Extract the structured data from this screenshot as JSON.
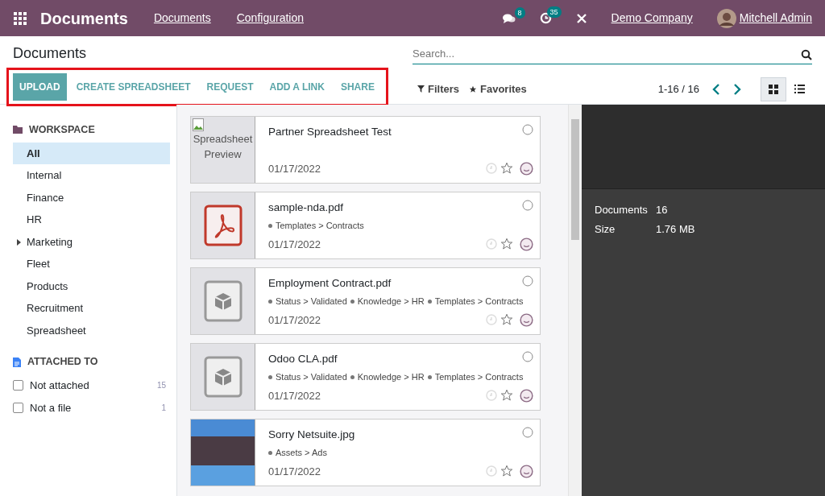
{
  "navbar": {
    "app_title": "Documents",
    "menu": [
      "Documents",
      "Configuration"
    ],
    "messages_count": "8",
    "activities_count": "35",
    "company": "Demo Company",
    "user": "Mitchell Admin"
  },
  "breadcrumb": "Documents",
  "search": {
    "placeholder": "Search..."
  },
  "toolbar": {
    "highlighted": true,
    "buttons": [
      {
        "label": "UPLOAD",
        "kind": "primary"
      },
      {
        "label": "CREATE SPREADSHEET",
        "kind": "link"
      },
      {
        "label": "REQUEST",
        "kind": "link"
      },
      {
        "label": "ADD A LINK",
        "kind": "link"
      },
      {
        "label": "SHARE",
        "kind": "link"
      }
    ]
  },
  "filters": [
    {
      "label": "Filters",
      "kind": "filter"
    },
    {
      "label": "Favorites",
      "kind": "favorite"
    }
  ],
  "pager": "1-16 / 16",
  "views": [
    {
      "kind": "kanban",
      "selected": true
    },
    {
      "kind": "list",
      "selected": false
    }
  ],
  "sidebar": {
    "sections": [
      {
        "title": "WORKSPACE",
        "kind": "folders",
        "items": [
          {
            "label": "All",
            "selected": true,
            "expandable": false
          },
          {
            "label": "Internal",
            "selected": false,
            "expandable": false
          },
          {
            "label": "Finance",
            "selected": false,
            "expandable": false
          },
          {
            "label": "HR",
            "selected": false,
            "expandable": false
          },
          {
            "label": "Marketing",
            "selected": false,
            "expandable": true
          },
          {
            "label": "Fleet",
            "selected": false,
            "expandable": false
          },
          {
            "label": "Products",
            "selected": false,
            "expandable": false
          },
          {
            "label": "Recruitment",
            "selected": false,
            "expandable": false
          },
          {
            "label": "Spreadsheet",
            "selected": false,
            "expandable": false
          }
        ]
      },
      {
        "title": "ATTACHED TO",
        "kind": "checkboxes",
        "items": [
          {
            "label": "Not attached",
            "count": "15",
            "checked": false
          },
          {
            "label": "Not a file",
            "count": "1",
            "checked": false
          }
        ]
      }
    ]
  },
  "documents": [
    {
      "name": "Partner Spreadsheet Test",
      "kind": "broken-image",
      "alt": "Spreadsheet Preview",
      "date": "01/17/2022",
      "selected": false,
      "favorite": false
    },
    {
      "name": "sample-nda.pdf",
      "kind": "pdf",
      "tags": [
        "Templates > Contracts"
      ],
      "date": "01/17/2022",
      "selected": false,
      "favorite": false
    },
    {
      "name": "Employment Contract.pdf",
      "kind": "binary",
      "tags": [
        "Status > Validated",
        "Knowledge > HR",
        "Templates > Contracts"
      ],
      "date": "01/17/2022",
      "selected": false,
      "favorite": false
    },
    {
      "name": "Odoo CLA.pdf",
      "kind": "binary",
      "tags": [
        "Status > Validated",
        "Knowledge > HR",
        "Templates > Contracts"
      ],
      "date": "01/17/2022",
      "selected": false,
      "favorite": false
    },
    {
      "name": "Sorry Netsuite.jpg",
      "kind": "photo",
      "tags": [
        "Assets > Ads"
      ],
      "date": "01/17/2022",
      "selected": false,
      "favorite": false
    }
  ],
  "details": {
    "rows": [
      {
        "label": "Documents",
        "value": "16"
      },
      {
        "label": "Size",
        "value": "1.76 MB"
      }
    ]
  }
}
